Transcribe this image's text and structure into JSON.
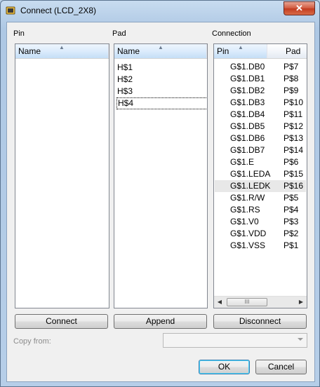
{
  "window": {
    "title": "Connect  (LCD_2X8)",
    "close_glyph": "✕"
  },
  "pin_panel": {
    "label": "Pin",
    "column": "Name",
    "items": []
  },
  "pad_panel": {
    "label": "Pad",
    "column": "Name",
    "items": [
      "H$1",
      "H$2",
      "H$3",
      "H$4"
    ]
  },
  "connection_panel": {
    "label": "Connection",
    "columns": [
      "Pin",
      "Pad"
    ],
    "rows": [
      {
        "pin": "G$1.DB0",
        "pad": "P$7"
      },
      {
        "pin": "G$1.DB1",
        "pad": "P$8"
      },
      {
        "pin": "G$1.DB2",
        "pad": "P$9"
      },
      {
        "pin": "G$1.DB3",
        "pad": "P$10"
      },
      {
        "pin": "G$1.DB4",
        "pad": "P$11"
      },
      {
        "pin": "G$1.DB5",
        "pad": "P$12"
      },
      {
        "pin": "G$1.DB6",
        "pad": "P$13"
      },
      {
        "pin": "G$1.DB7",
        "pad": "P$14"
      },
      {
        "pin": "G$1.E",
        "pad": "P$6"
      },
      {
        "pin": "G$1.LEDA",
        "pad": "P$15"
      },
      {
        "pin": "G$1.LEDK",
        "pad": "P$16"
      },
      {
        "pin": "G$1.R/W",
        "pad": "P$5"
      },
      {
        "pin": "G$1.RS",
        "pad": "P$4"
      },
      {
        "pin": "G$1.V0",
        "pad": "P$3"
      },
      {
        "pin": "G$1.VDD",
        "pad": "P$2"
      },
      {
        "pin": "G$1.VSS",
        "pad": "P$1"
      }
    ],
    "scroll_thumb_glyph": "III"
  },
  "buttons": {
    "connect": "Connect",
    "append": "Append",
    "disconnect": "Disconnect",
    "ok": "OK",
    "cancel": "Cancel"
  },
  "copy_from": {
    "label": "Copy from:",
    "value": ""
  },
  "colors": {
    "selected_row": "#e8e8e8",
    "default_button_border": "#3c7fb1",
    "close_button": "#c94a2f"
  }
}
